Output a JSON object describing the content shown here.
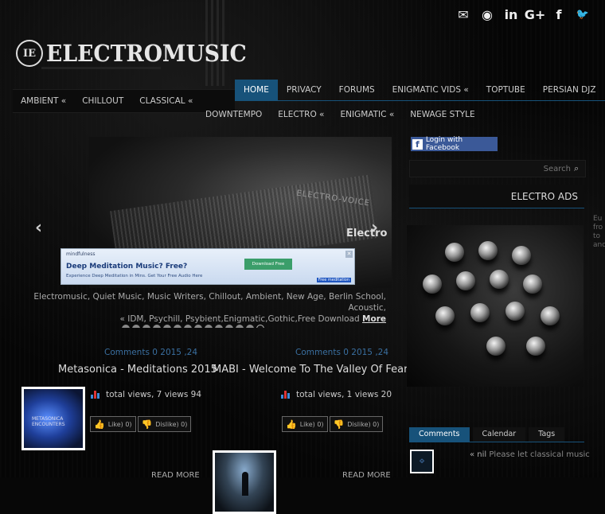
{
  "social": [
    {
      "name": "email-icon",
      "glyph": "✉"
    },
    {
      "name": "rss-icon",
      "glyph": "◉"
    },
    {
      "name": "linkedin-icon",
      "glyph": "in"
    },
    {
      "name": "googleplus-icon",
      "glyph": "G+"
    },
    {
      "name": "facebook-icon",
      "glyph": "f"
    },
    {
      "name": "twitter-icon",
      "glyph": "🐦"
    }
  ],
  "logo": {
    "badge": "IE",
    "text": "ELECTROMUSIC"
  },
  "nav": {
    "main": [
      "HOME",
      "PRIVACY",
      "FORUMS",
      "ENIGMATIC VIDS «",
      "TOPTUBE",
      "PERSIAN DJZ"
    ],
    "sub1": [
      "AMBIENT «",
      "CHILLOUT",
      "CLASSICAL «"
    ],
    "sub2": [
      "DOWNTEMPO",
      "ELECTRO «",
      "ENIGMATIC «",
      "NEWAGE STYLE"
    ]
  },
  "slider": {
    "caption": "Electro",
    "mic_label": "ELECTRO-VOICE",
    "prev": "‹",
    "next": "›",
    "ad": {
      "brand": "mindfulness",
      "title": "Deep Meditation Music? Free?",
      "subtitle": "Experience Deep Meditation in Mins. Get Your Free Audio Here",
      "button": "Download Free",
      "close": "✕",
      "footer": "Free meditation"
    },
    "tags_line1": "Electromusic, Quiet Music, Music Writers, Chillout, Ambient, New Age, Berlin School, Acoustic,",
    "tags_line2": "« IDM, Psychill, Psybient,Enigmatic,Gothic,Free Download",
    "more": "More",
    "dots": 14,
    "active_dot": 13
  },
  "posts": [
    {
      "meta": "Comments 0   2015 ,24",
      "title": "Metasonica - Meditations 2015",
      "thumb_text": "METASONICA\nENCOUNTERS",
      "views": "total views, 7 views 94",
      "like": "Like) 0)",
      "dislike": "Dislike) 0)",
      "read_more": "READ MORE"
    },
    {
      "meta": "Comments 0   2015 ,24",
      "title": "MABI - Welcome To The Valley Of Fear",
      "thumb_text": "",
      "views": "total views, 1 views 20",
      "like": "Like) 0)",
      "dislike": "Dislike) 0)",
      "read_more": "READ MORE"
    }
  ],
  "sidebar": {
    "facebook_login": "Login with Facebook",
    "search_placeholder": "Search",
    "ads_heading": "ELECTRO ADS",
    "tabs": [
      "Comments",
      "Calendar",
      "Tags"
    ],
    "comment_user": "« nil",
    "comment_text": "Please let classical music",
    "edge_text": "Eu\nfro\nto\nand"
  },
  "colors": {
    "accent": "#17527a",
    "link": "#3a6fa0",
    "facebook": "#3b5998"
  }
}
